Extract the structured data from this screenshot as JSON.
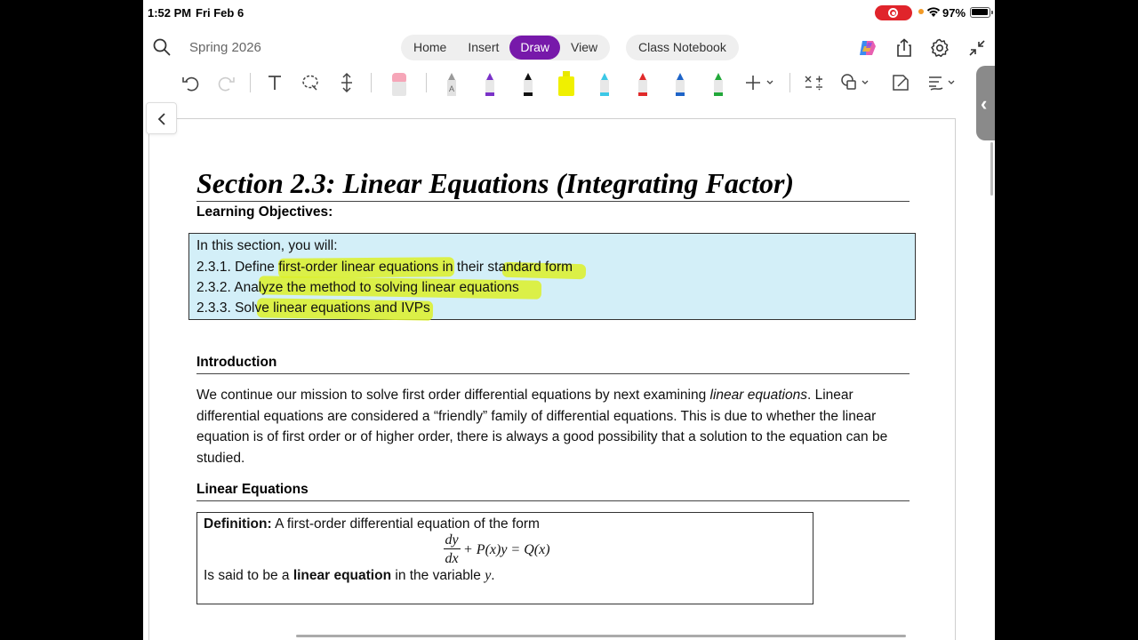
{
  "status": {
    "time": "1:52 PM",
    "date": "Fri Feb 6",
    "battery": "97%"
  },
  "nav": {
    "notebook_title": "Spring 2026",
    "tabs": [
      {
        "label": "Home",
        "active": false
      },
      {
        "label": "Insert",
        "active": false
      },
      {
        "label": "Draw",
        "active": true
      },
      {
        "label": "View",
        "active": false
      }
    ],
    "class_notebook": "Class Notebook"
  },
  "toolbar": {
    "pen_colors": [
      "#9a9a9a",
      "#7a32c8",
      "#111111",
      "#f0f000",
      "#3cc8e6",
      "#e02a2a",
      "#1e64c8",
      "#22a83a"
    ]
  },
  "doc": {
    "section_title": "Section 2.3: Linear Equations (Integrating Factor)",
    "objectives_heading": "Learning Objectives:",
    "objectives": [
      "In this section, you will:",
      "2.3.1. Define first-order linear equations in their standard form",
      "2.3.2. Analyze the method to solving linear equations",
      "2.3.3. Solve linear equations and IVPs"
    ],
    "intro_heading": "Introduction",
    "intro_pre": "We continue our mission to solve first order differential equations by next examining ",
    "intro_em": "linear equations",
    "intro_post": ". Linear differential equations are considered a “friendly” family of differential equations. This is due to whether the linear equation is of first order or of higher order, there is always a good possibility that a solution to the equation can be studied.",
    "linear_heading": "Linear Equations",
    "definition": {
      "label": "Definition:",
      "text": " A first-order differential equation of the form",
      "numerator": "dy",
      "denominator": "dx",
      "rest": "+ P(x)y = Q(x)",
      "line2_pre": "Is said to be a ",
      "line2_bold": "linear equation",
      "line2_mid": " in the variable ",
      "line2_var": "y",
      "line2_end": "."
    }
  }
}
